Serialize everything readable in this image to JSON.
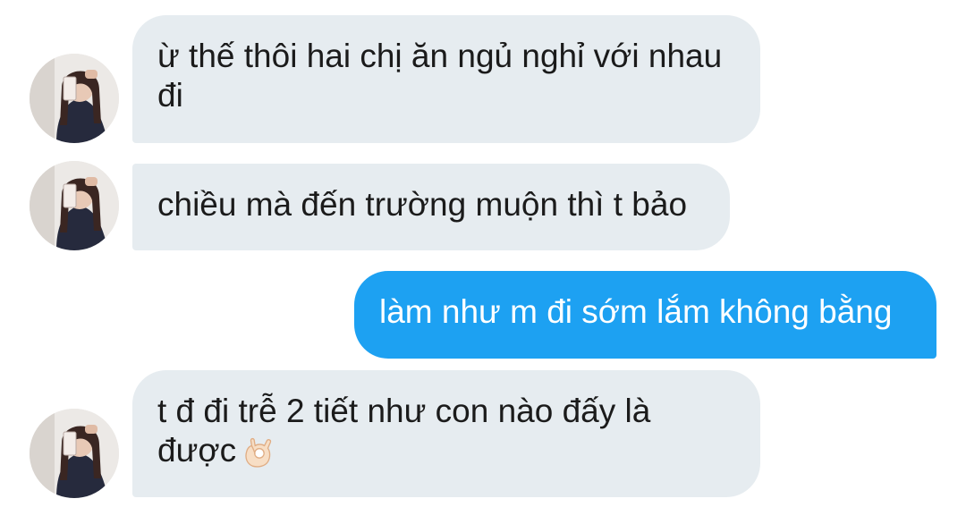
{
  "conversation": {
    "messages": [
      {
        "direction": "incoming",
        "text": "ừ thế thôi hai chị ăn ngủ nghỉ với nhau đi"
      },
      {
        "direction": "incoming",
        "text": "chiều mà đến trường muộn thì t bảo"
      },
      {
        "direction": "outgoing",
        "text": "làm như m đi sớm lắm không bằng"
      },
      {
        "direction": "incoming",
        "text": "t đ đi trễ 2 tiết như con nào đấy là được",
        "emoji": "ok-hand-icon"
      }
    ]
  },
  "colors": {
    "incoming_bubble": "#e6ecf0",
    "outgoing_bubble": "#1da1f2",
    "incoming_text": "#1b1b1b",
    "outgoing_text": "#ffffff"
  }
}
